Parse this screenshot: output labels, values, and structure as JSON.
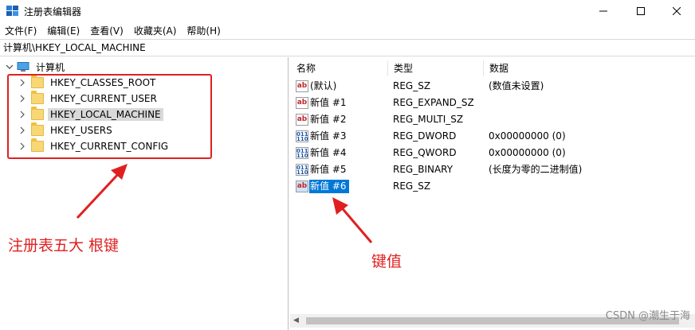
{
  "window": {
    "title": "注册表编辑器",
    "minimize_icon": "minimize-icon",
    "maximize_icon": "maximize-icon",
    "close_icon": "close-icon"
  },
  "menu": {
    "items": [
      "文件(F)",
      "编辑(E)",
      "查看(V)",
      "收藏夹(A)",
      "帮助(H)"
    ]
  },
  "address": {
    "path": "计算机\\HKEY_LOCAL_MACHINE"
  },
  "tree": {
    "root_label": "计算机",
    "items": [
      {
        "label": "HKEY_CLASSES_ROOT",
        "selected": false
      },
      {
        "label": "HKEY_CURRENT_USER",
        "selected": false
      },
      {
        "label": "HKEY_LOCAL_MACHINE",
        "selected": true
      },
      {
        "label": "HKEY_USERS",
        "selected": false
      },
      {
        "label": "HKEY_CURRENT_CONFIG",
        "selected": false
      }
    ]
  },
  "list": {
    "columns": [
      "名称",
      "类型",
      "数据"
    ],
    "rows": [
      {
        "icon": "ab",
        "name": "(默认)",
        "type": "REG_SZ",
        "data": "(数值未设置)",
        "selected": false
      },
      {
        "icon": "ab",
        "name": "新值 #1",
        "type": "REG_EXPAND_SZ",
        "data": "",
        "selected": false
      },
      {
        "icon": "ab",
        "name": "新值 #2",
        "type": "REG_MULTI_SZ",
        "data": "",
        "selected": false
      },
      {
        "icon": "bin",
        "name": "新值 #3",
        "type": "REG_DWORD",
        "data": "0x00000000 (0)",
        "selected": false
      },
      {
        "icon": "bin",
        "name": "新值 #4",
        "type": "REG_QWORD",
        "data": "0x00000000 (0)",
        "selected": false
      },
      {
        "icon": "bin",
        "name": "新值 #5",
        "type": "REG_BINARY",
        "data": "(长度为零的二进制值)",
        "selected": false
      },
      {
        "icon": "ab",
        "name": "新值 #6",
        "type": "REG_SZ",
        "data": "",
        "selected": true
      }
    ]
  },
  "annotations": {
    "root_keys_label": "注册表五大 根键",
    "key_value_label": "键值",
    "color": "#e02020"
  },
  "watermark": "CSDN @潮生于海"
}
